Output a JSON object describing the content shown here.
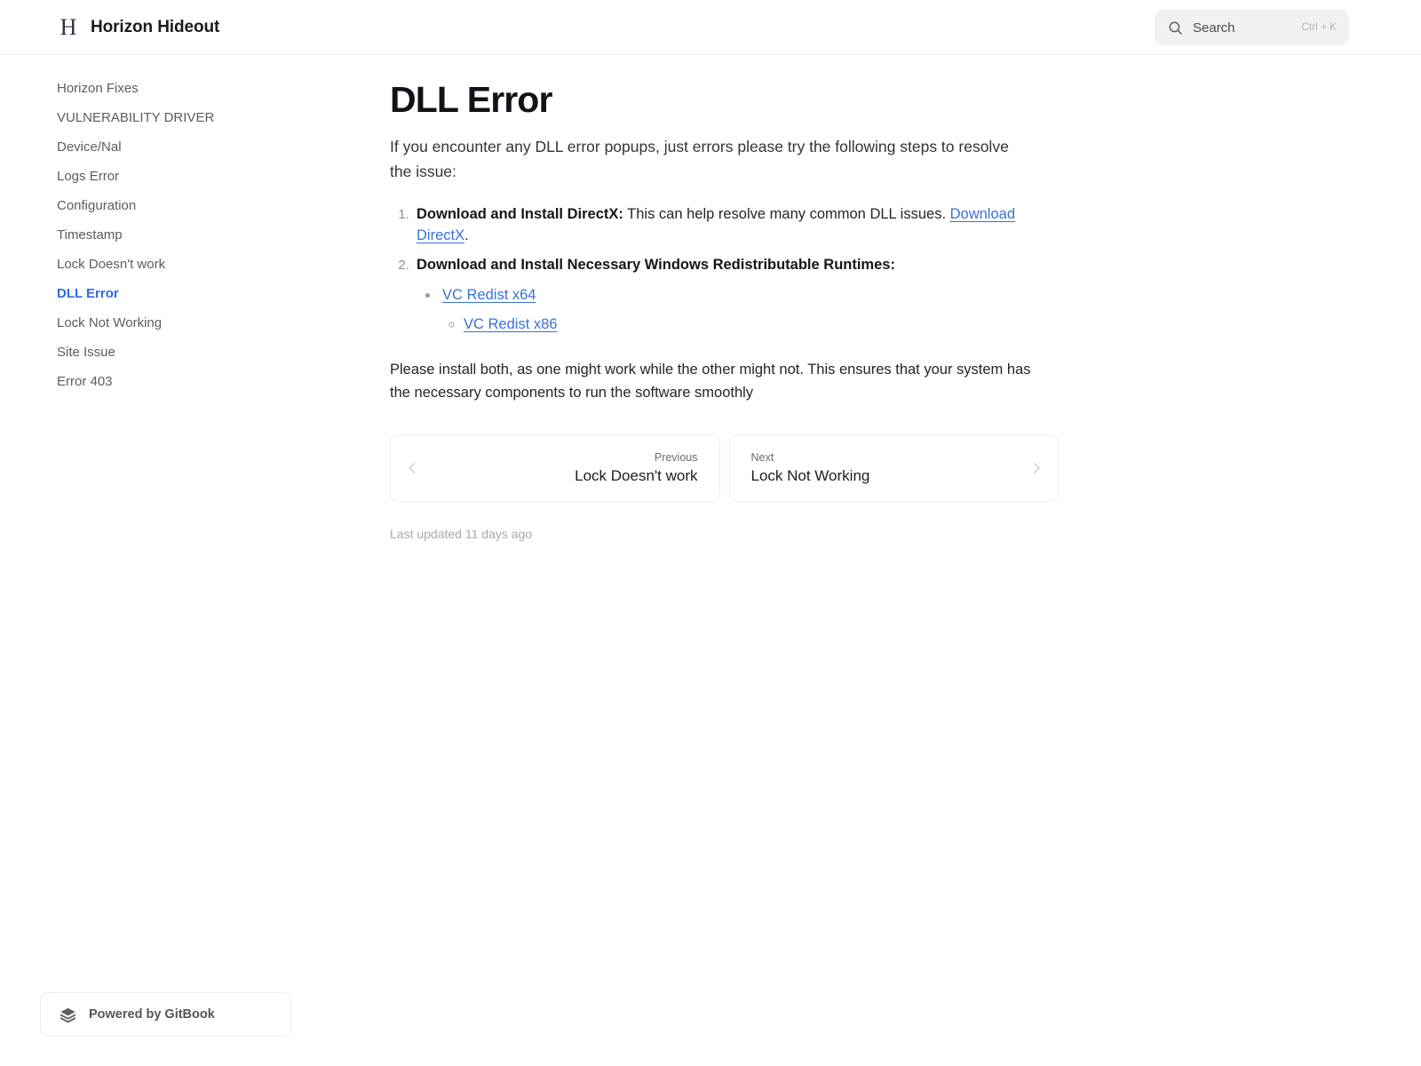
{
  "header": {
    "logo_letter": "H",
    "logo_icon": "h-monogram-icon",
    "title": "Horizon Hideout",
    "search": {
      "icon": "search-icon",
      "label": "Search",
      "shortcut": "Ctrl + K"
    }
  },
  "sidebar": {
    "items": [
      {
        "label": "Horizon Fixes",
        "active": false
      },
      {
        "label": "VULNERABILITY DRIVER",
        "active": false
      },
      {
        "label": "Device/Nal",
        "active": false
      },
      {
        "label": "Logs Error",
        "active": false
      },
      {
        "label": "Configuration",
        "active": false
      },
      {
        "label": "Timestamp",
        "active": false
      },
      {
        "label": "Lock Doesn't work",
        "active": false
      },
      {
        "label": "DLL Error",
        "active": true
      },
      {
        "label": "Lock Not Working",
        "active": false
      },
      {
        "label": "Site Issue",
        "active": false
      },
      {
        "label": "Error 403",
        "active": false
      }
    ],
    "badge": {
      "icon": "gitbook-layers-icon",
      "label": "Powered by GitBook"
    }
  },
  "main": {
    "title": "DLL Error",
    "intro": "If you encounter any DLL error popups, just errors please try the following steps to resolve the issue:",
    "steps": [
      {
        "strong": "Download and Install DirectX:",
        "text": " This can help resolve many common DLL issues. ",
        "link": "Download DirectX",
        "suffix": "."
      },
      {
        "strong": "Download and Install Necessary Windows Redistributable Runtimes:",
        "text": "",
        "sub_items": [
          {
            "link": "VC Redist x64"
          },
          {
            "link": "VC Redist x86"
          }
        ]
      }
    ],
    "outro": "Please install both, as one might work while the other might not. This ensures that your system has the necessary components to run the software smoothly",
    "pagination": {
      "previous": {
        "kicker": "Previous",
        "title": "Lock Doesn't work",
        "icon": "chevron-left-icon"
      },
      "next": {
        "kicker": "Next",
        "title": "Lock Not Working",
        "icon": "chevron-right-icon"
      }
    },
    "last_updated": "Last updated 11 days ago"
  },
  "colors": {
    "accent": "#2d6ce0",
    "link": "#3871d8",
    "text": "#24242b",
    "muted": "#5c5c61"
  }
}
